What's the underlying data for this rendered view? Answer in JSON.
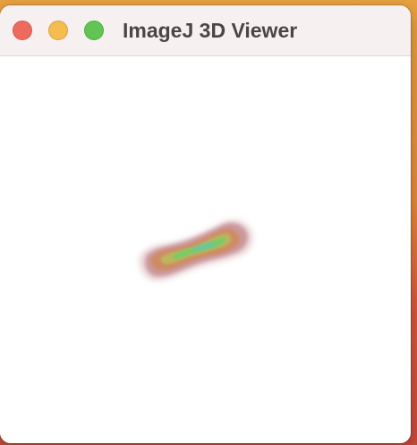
{
  "window": {
    "title": "ImageJ 3D Viewer"
  },
  "controls": {
    "close": "close-button",
    "minimize": "minimize-button",
    "zoom": "zoom-button"
  },
  "colors": {
    "close": "#ee6a5f",
    "minimize": "#f5bd4f",
    "zoom": "#61c454",
    "titlebar": "#f6f1f0",
    "title_text": "#4a4647",
    "volume_outer": "#b86a6d",
    "volume_core": "#d98a4a",
    "volume_center": "#7fcf66",
    "volume_highlight": "#66c3b0"
  },
  "viewer": {
    "content": "3D volume rendering"
  }
}
